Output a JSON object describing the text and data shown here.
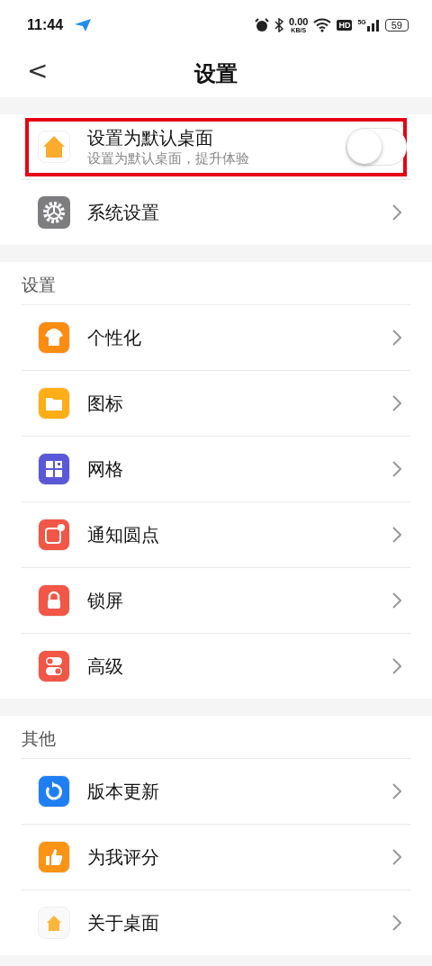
{
  "status_bar": {
    "time": "11:44",
    "net_speed": "0.00",
    "net_unit": "KB/S",
    "hd": "HD",
    "network": "5G",
    "battery": "59"
  },
  "header": {
    "back": "<",
    "title": "设置"
  },
  "top_items": [
    {
      "label": "设置为默认桌面",
      "subtitle": "设置为默认桌面，提升体验",
      "kind": "toggle",
      "on": false,
      "highlighted": true
    },
    {
      "label": "系统设置",
      "kind": "link",
      "highlighted": false
    }
  ],
  "sections": [
    {
      "title": "设置",
      "items": [
        {
          "label": "个性化",
          "color": "#fb8c12"
        },
        {
          "label": "图标",
          "color": "#fdae16"
        },
        {
          "label": "网格",
          "color": "#5a58d6"
        },
        {
          "label": "通知圆点",
          "color": "#f15646"
        },
        {
          "label": "锁屏",
          "color": "#f15646"
        },
        {
          "label": "高级",
          "color": "#f15646"
        }
      ]
    },
    {
      "title": "其他",
      "items": [
        {
          "label": "版本更新",
          "color": "#1f7ff2"
        },
        {
          "label": "为我评分",
          "color": "#fb9314"
        },
        {
          "label": "关于桌面",
          "color": "#f9f9f9"
        }
      ]
    }
  ]
}
